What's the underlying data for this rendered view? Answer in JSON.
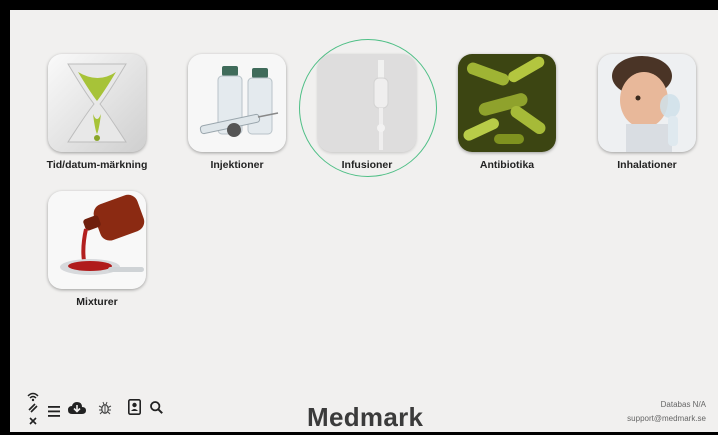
{
  "tiles": [
    {
      "label": "Tid/datum-märkning",
      "icon": "hourglass-icon"
    },
    {
      "label": "Injektioner",
      "icon": "vials-syringe-icon"
    },
    {
      "label": "Infusioner",
      "icon": "iv-drip-icon"
    },
    {
      "label": "Antibiotika",
      "icon": "bacteria-icon"
    },
    {
      "label": "Inhalationer",
      "icon": "child-inhaler-icon"
    },
    {
      "label": "Mixturer",
      "icon": "syrup-bottle-icon"
    }
  ],
  "selected_tile": "Infusioner",
  "footer": {
    "logo_prefix": "Med",
    "logo_m": "m",
    "logo_suffix": "ark",
    "database": "Databas N/A",
    "email": "support@medmark.se"
  },
  "toolbar": [
    "wifi-link-status-icon",
    "menu-icon",
    "cloud-download-icon",
    "bug-icon",
    "contact-card-icon",
    "search-icon"
  ],
  "colors": {
    "selection_ring": "#4fbf86",
    "background": "#f1f0ef"
  }
}
